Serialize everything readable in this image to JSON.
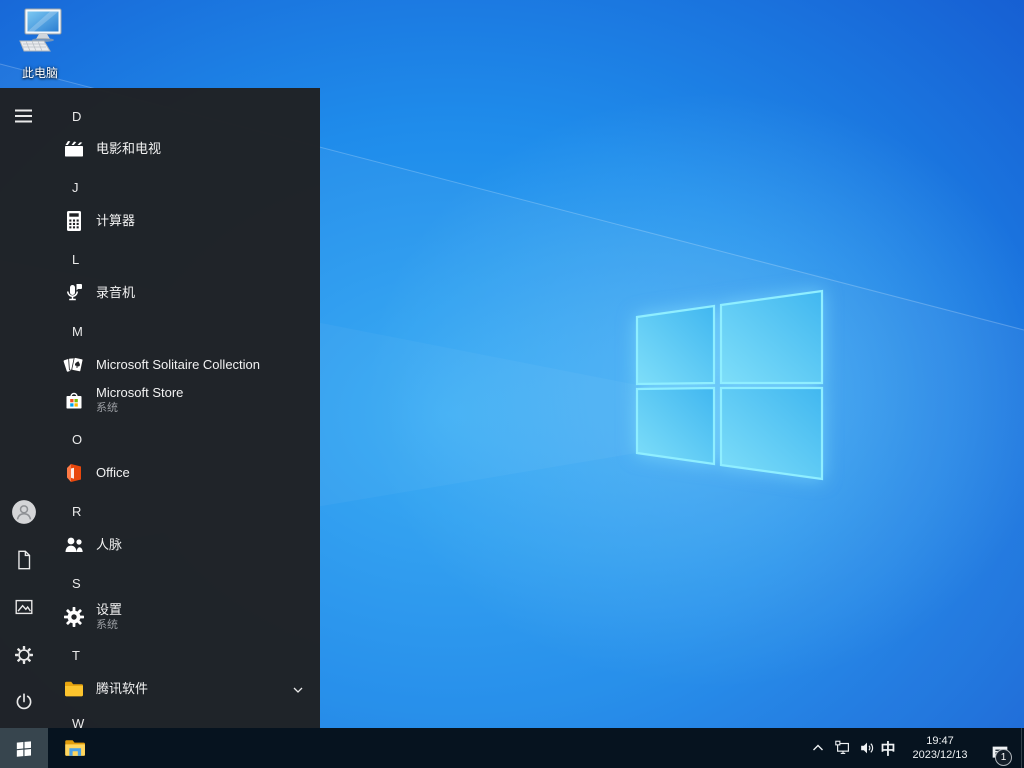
{
  "desktop": {
    "this_pc_label": "此电脑"
  },
  "start_menu": {
    "letters": {
      "d": "D",
      "j": "J",
      "l": "L",
      "m": "M",
      "o": "O",
      "r": "R",
      "s": "S",
      "t": "T",
      "w": "W"
    },
    "apps": {
      "movies": {
        "label": "电影和电视",
        "icon": "clapperboard-icon"
      },
      "calculator": {
        "label": "计算器",
        "icon": "calculator-icon"
      },
      "recorder": {
        "label": "录音机",
        "icon": "microphone-icon"
      },
      "solitaire": {
        "label": "Microsoft Solitaire Collection",
        "icon": "playing-cards-icon"
      },
      "store": {
        "label": "Microsoft Store",
        "sublabel": "系统",
        "icon": "store-bag-icon"
      },
      "office": {
        "label": "Office",
        "icon": "office-logo-icon"
      },
      "people": {
        "label": "人脉",
        "icon": "people-icon"
      },
      "settings": {
        "label": "设置",
        "sublabel": "系统",
        "icon": "gear-icon"
      },
      "tencent": {
        "label": "腾讯软件",
        "icon": "folder-icon",
        "expand_icon": "chevron-down-icon"
      }
    },
    "rail_icons": [
      "menu-icon",
      "user-avatar-icon",
      "documents-icon",
      "pictures-icon",
      "settings-gear-icon",
      "power-icon"
    ]
  },
  "taskbar": {
    "start_icon": "windows-logo-icon",
    "explorer_icon": "file-explorer-icon",
    "ime_indicator": "中",
    "clock": {
      "time": "19:47",
      "date": "2023/12/13"
    },
    "action_center_badge": "1",
    "tray_icons": [
      "chevron-up-icon",
      "network-icon",
      "volume-icon",
      "ime-indicator",
      "clock",
      "action-center-icon"
    ]
  },
  "colors": {
    "wallpaper_center": "#31a8f4",
    "wallpaper_edge": "#1243bc",
    "logo_pane": "#55c8f5",
    "logo_border": "#8feeff",
    "menu_bg": "#202225",
    "taskbar_bg": "#06131f",
    "start_button_bg": "#37454e",
    "folder_yellow": "#fdc52e",
    "office_orange": "#e8470c",
    "store_squares": [
      "#f25022",
      "#7fba00",
      "#00a4ef",
      "#ffb900"
    ]
  }
}
